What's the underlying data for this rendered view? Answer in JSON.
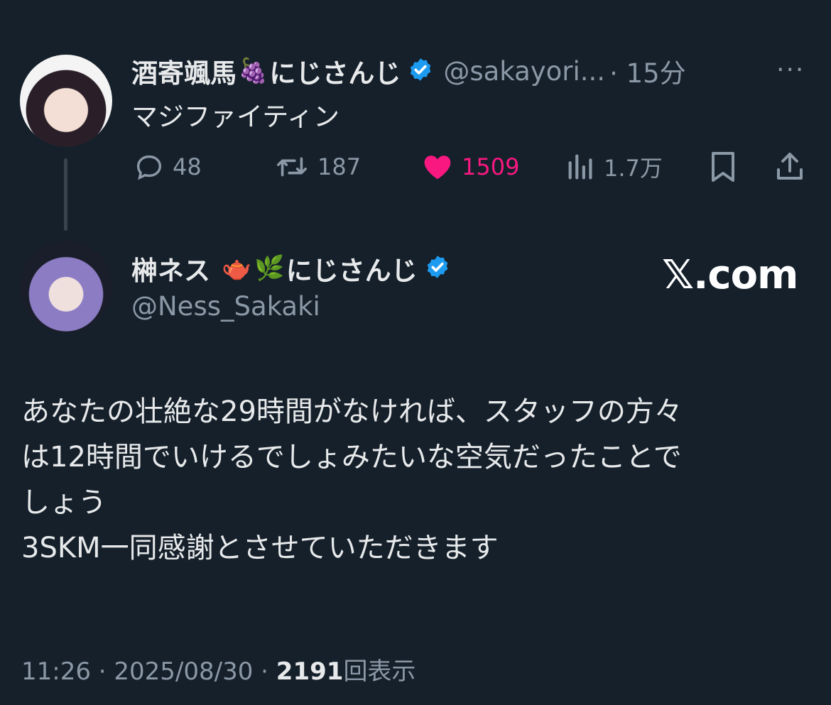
{
  "parent_tweet": {
    "name": "酒寄颯馬",
    "name_emoji": "🍇",
    "name_suffix": "にじさんじ",
    "handle": "@sakayori...",
    "time": "· 15分",
    "text": "マジファイティン",
    "more": "···",
    "actions": {
      "replies": "48",
      "retweets": "187",
      "likes": "1509",
      "views": "1.7万"
    },
    "colors": {
      "like": "#f91880",
      "verified": "#1d9bf0"
    }
  },
  "reply_tweet": {
    "name": "榊ネス",
    "emoji1": "🫖",
    "emoji2": "🌿",
    "name_suffix": "にじさんじ",
    "handle": "@Ness_Sakaki",
    "watermark": "𝕏.com",
    "lines": [
      "あなたの壮絶な29時間がなければ、スタッフの方々",
      "は12時間でいけるでしょみたいな空気だったことで",
      "しょう",
      "3SKM一同感謝とさせていただきます"
    ],
    "meta_time": "11:26 · 2025/08/30 · ",
    "view_count": "2191",
    "view_label": "回表示"
  }
}
